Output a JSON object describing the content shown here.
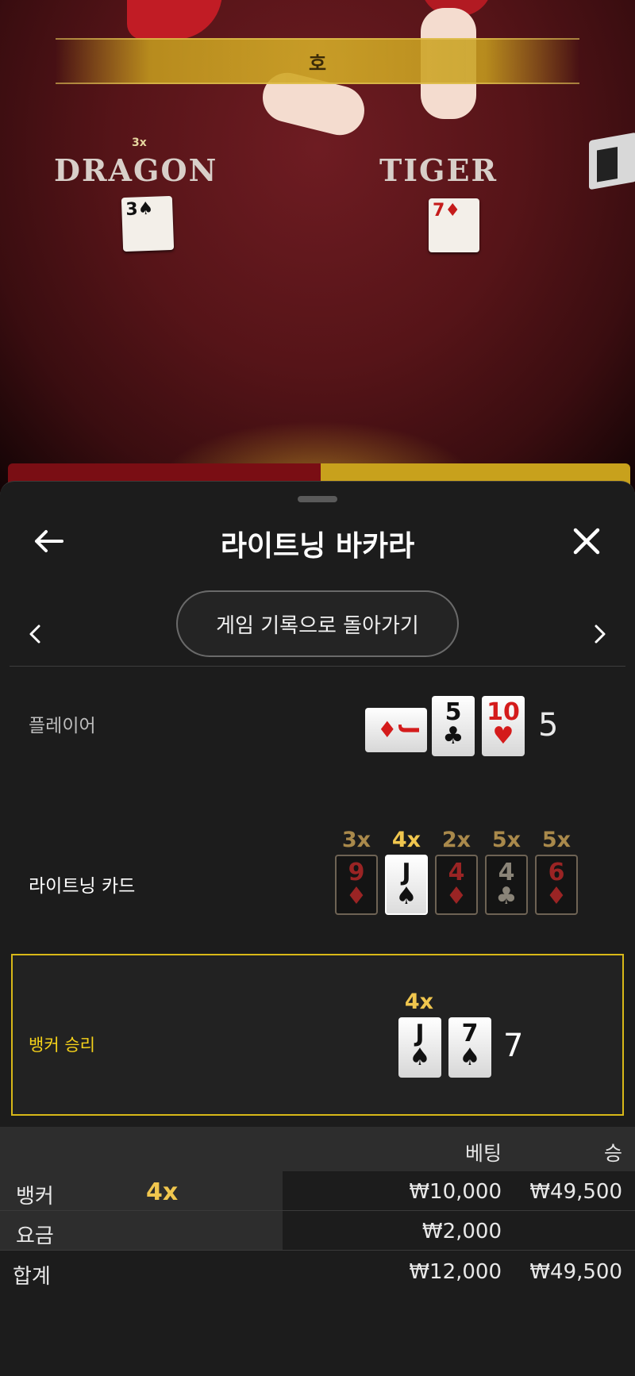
{
  "video": {
    "banner_text": "호",
    "dragon_label": "DRAGON",
    "tiger_label": "TIGER",
    "dragon_mult": "3x",
    "dragon_card": {
      "rank": "3",
      "suit": "♠"
    },
    "tiger_card": {
      "rank": "7",
      "suit": "♦"
    }
  },
  "header": {
    "title": "라이트닝 바카라",
    "back_icon": "arrow-left-icon",
    "close_icon": "close-icon"
  },
  "nav": {
    "back_to_history": "게임 기록으로 돌아가기",
    "prev_icon": "chevron-left-icon",
    "next_icon": "chevron-right-icon"
  },
  "player": {
    "label": "플레이어",
    "cards": [
      {
        "rank": "J",
        "suit": "♦",
        "color": "red",
        "orientation": "sideways"
      },
      {
        "rank": "5",
        "suit": "♣",
        "color": "black"
      },
      {
        "rank": "10",
        "suit": "♥",
        "color": "red"
      }
    ],
    "score": "5"
  },
  "lightning": {
    "label": "라이트닝 카드",
    "cards": [
      {
        "mult": "3x",
        "rank": "9",
        "suit": "♦",
        "active": false
      },
      {
        "mult": "4x",
        "rank": "J",
        "suit": "♠",
        "active": true
      },
      {
        "mult": "2x",
        "rank": "4",
        "suit": "♦",
        "active": false
      },
      {
        "mult": "5x",
        "rank": "4",
        "suit": "♣",
        "active": false
      },
      {
        "mult": "5x",
        "rank": "6",
        "suit": "♦",
        "active": false
      }
    ]
  },
  "banker": {
    "label": "뱅커 승리",
    "mult": "4x",
    "cards": [
      {
        "rank": "J",
        "suit": "♠"
      },
      {
        "rank": "7",
        "suit": "♠"
      }
    ],
    "score": "7"
  },
  "bets": {
    "col_bet": "베팅",
    "col_win": "승",
    "rows": [
      {
        "name": "뱅커",
        "mult": "4x",
        "bet": "₩10,000",
        "win": "₩49,500"
      },
      {
        "name": "요금",
        "mult": "",
        "bet": "₩2,000",
        "win": ""
      }
    ],
    "total": {
      "name": "합계",
      "bet": "₩12,000",
      "win": "₩49,500"
    }
  },
  "colors": {
    "accent_gold": "#f0c64e",
    "banker_border": "#d8b818",
    "sheet_bg": "#1c1c1c"
  }
}
